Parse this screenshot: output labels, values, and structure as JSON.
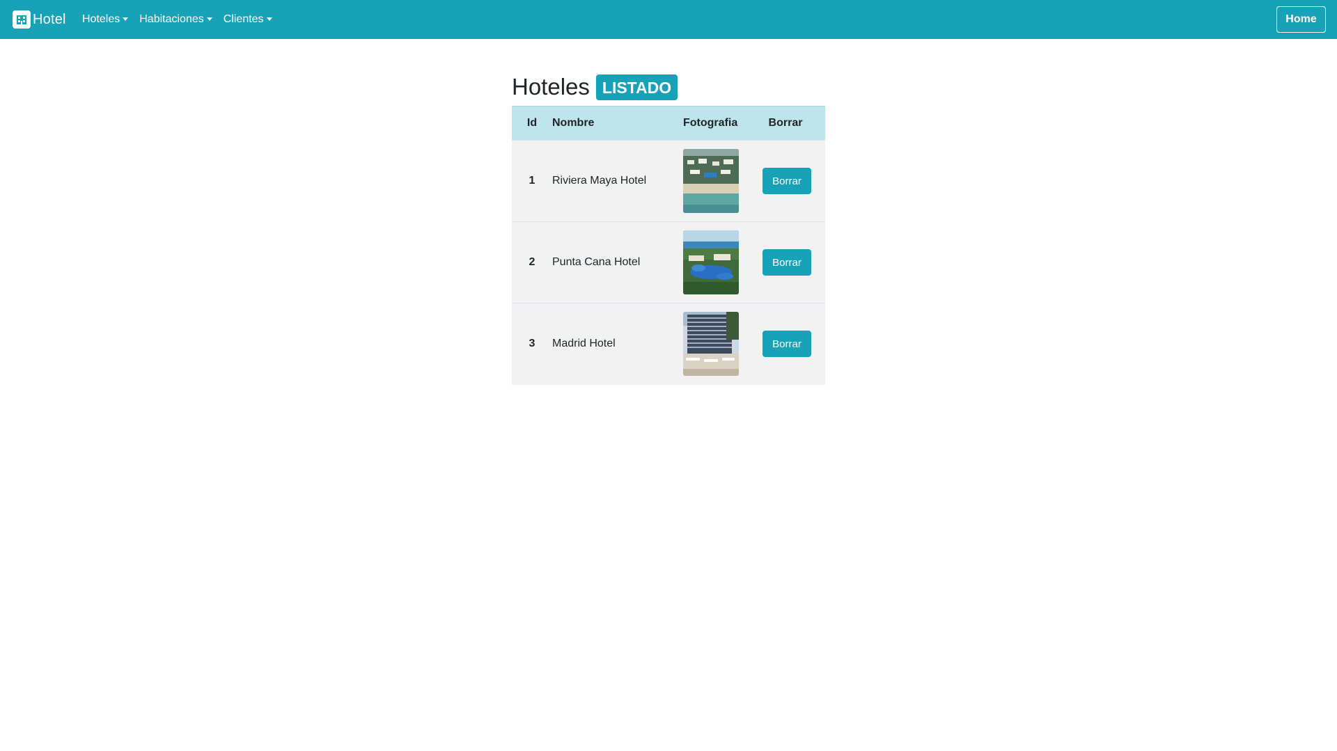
{
  "navbar": {
    "brand_label": "Hotel",
    "brand_icon": "hotel-icon",
    "menus": [
      {
        "label": "Hoteles"
      },
      {
        "label": "Habitaciones"
      },
      {
        "label": "Clientes"
      }
    ],
    "home_label": "Home"
  },
  "page": {
    "title": "Hoteles",
    "badge": "LISTADO"
  },
  "table": {
    "headers": {
      "id": "Id",
      "name": "Nombre",
      "photo": "Fotografia",
      "delete": "Borrar"
    },
    "rows": [
      {
        "id": "1",
        "name": "Riviera Maya Hotel",
        "photo": "aerial-beach-resort-photo",
        "delete_label": "Borrar"
      },
      {
        "id": "2",
        "name": "Punta Cana Hotel",
        "photo": "tropical-pool-resort-photo",
        "delete_label": "Borrar"
      },
      {
        "id": "3",
        "name": "Madrid Hotel",
        "photo": "city-hotel-building-photo",
        "delete_label": "Borrar"
      }
    ]
  },
  "colors": {
    "primary": "#17a2b8",
    "table_header": "#bee5eb",
    "row_bg": "#f2f2f2",
    "text": "#212529"
  }
}
